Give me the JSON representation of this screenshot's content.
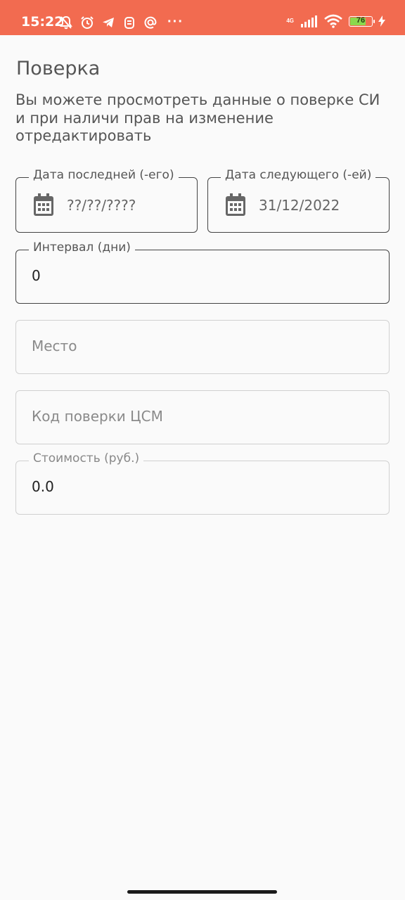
{
  "status_bar": {
    "time": "15:22",
    "network": "4G",
    "battery_level": "76",
    "battery_fraction": 0.76,
    "color": "#f26b50"
  },
  "page": {
    "title": "Поверка",
    "description": "Вы можете просмотреть данные о поверке СИ и при наличи прав на изменение отредактировать"
  },
  "fields": {
    "last_date": {
      "label": "Дата последней (-его)",
      "value": "??/??/????",
      "icon": "calendar-icon"
    },
    "next_date": {
      "label": "Дата следующего (-ей)",
      "value": "31/12/2022",
      "icon": "calendar-icon"
    },
    "interval": {
      "label": "Интервал (дни)",
      "value": "0"
    },
    "place": {
      "placeholder": "Место"
    },
    "csm_code": {
      "placeholder": "Код поверки ЦСМ"
    },
    "cost": {
      "label": "Стоимость (руб.)",
      "value": "0.0"
    }
  }
}
